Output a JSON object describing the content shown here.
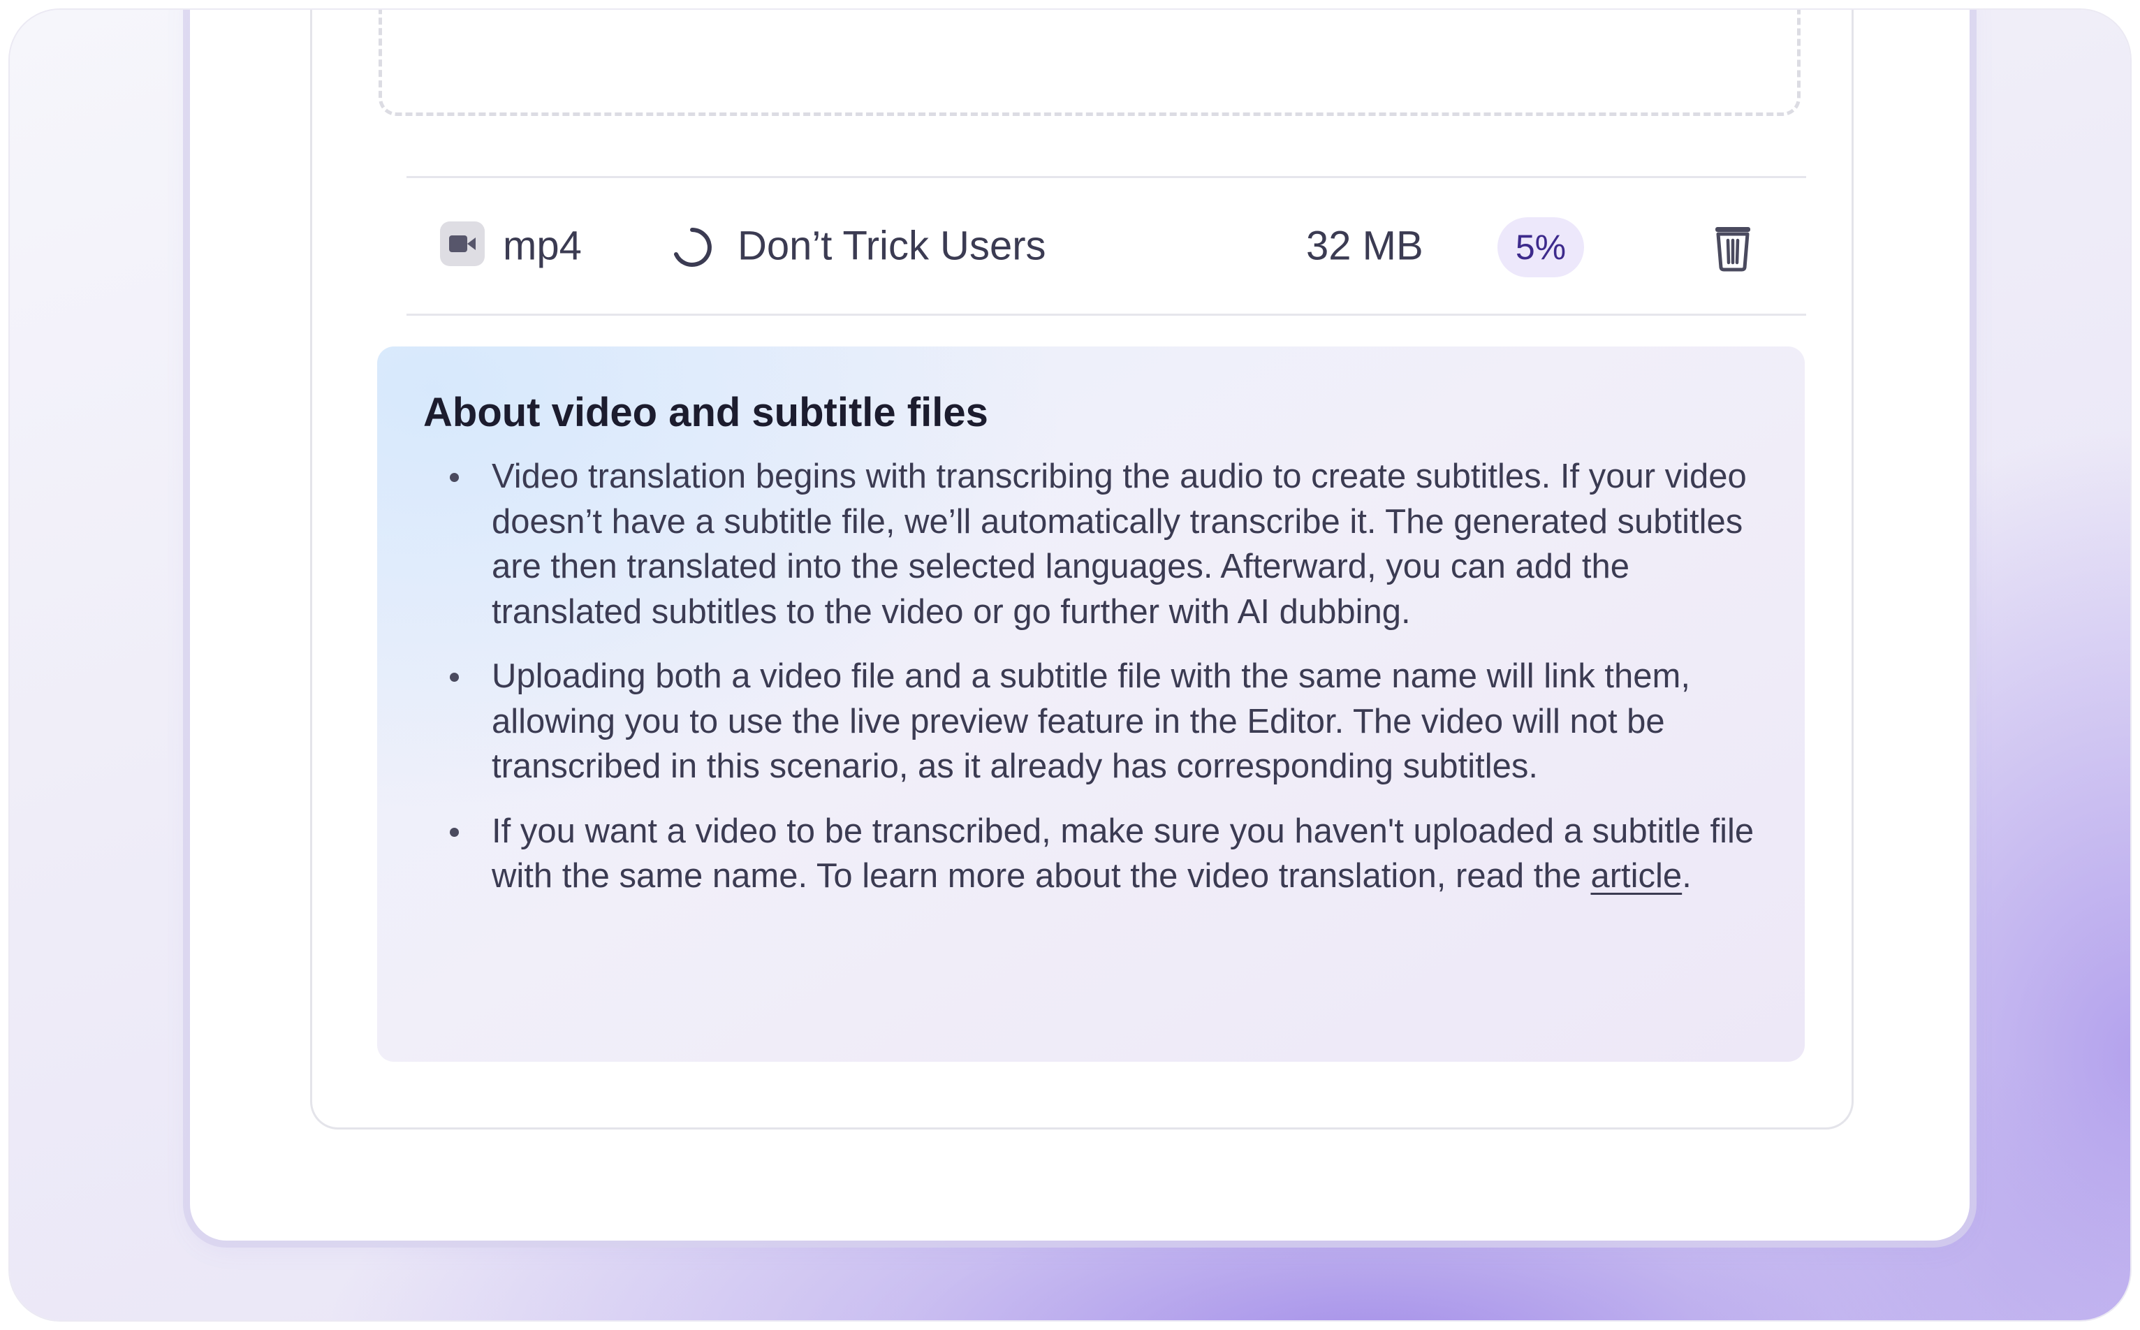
{
  "upload_list": {
    "file": {
      "type_label": "mp4",
      "type_icon": "video-camera-icon",
      "status_icon": "loading-spinner-icon",
      "name": "Don’t Trick Users",
      "size": "32 MB",
      "progress": "5%",
      "progress_value": 0.05,
      "delete_icon": "trash-icon"
    }
  },
  "info": {
    "title": "About video and subtitle files",
    "items": [
      "Video translation begins with transcribing the audio to create subtitles. If your video doesn’t have a subtitle file, we’ll automatically transcribe it. The generated subtitles are then translated into the selected languages. Afterward, you can add the translated subtitles to the video or go further with AI dubbing.",
      "Uploading both a video file and a subtitle file with the same name will link them, allowing you to use the live preview feature in the Editor. The video will not be transcribed in this scenario, as it already has corresponding subtitles."
    ],
    "item3": {
      "text_before_link": "If you want a video to be transcribed, make sure you haven't uploaded a subtitle file with the same name. To learn more about the video translation, read the ",
      "link_text": "article",
      "text_after_link": "."
    }
  },
  "colors": {
    "accent_badge_bg": "#ede8fb",
    "accent_badge_text": "#3d2a8c",
    "text_primary": "#3b3b52",
    "title": "#1c1c2e"
  }
}
